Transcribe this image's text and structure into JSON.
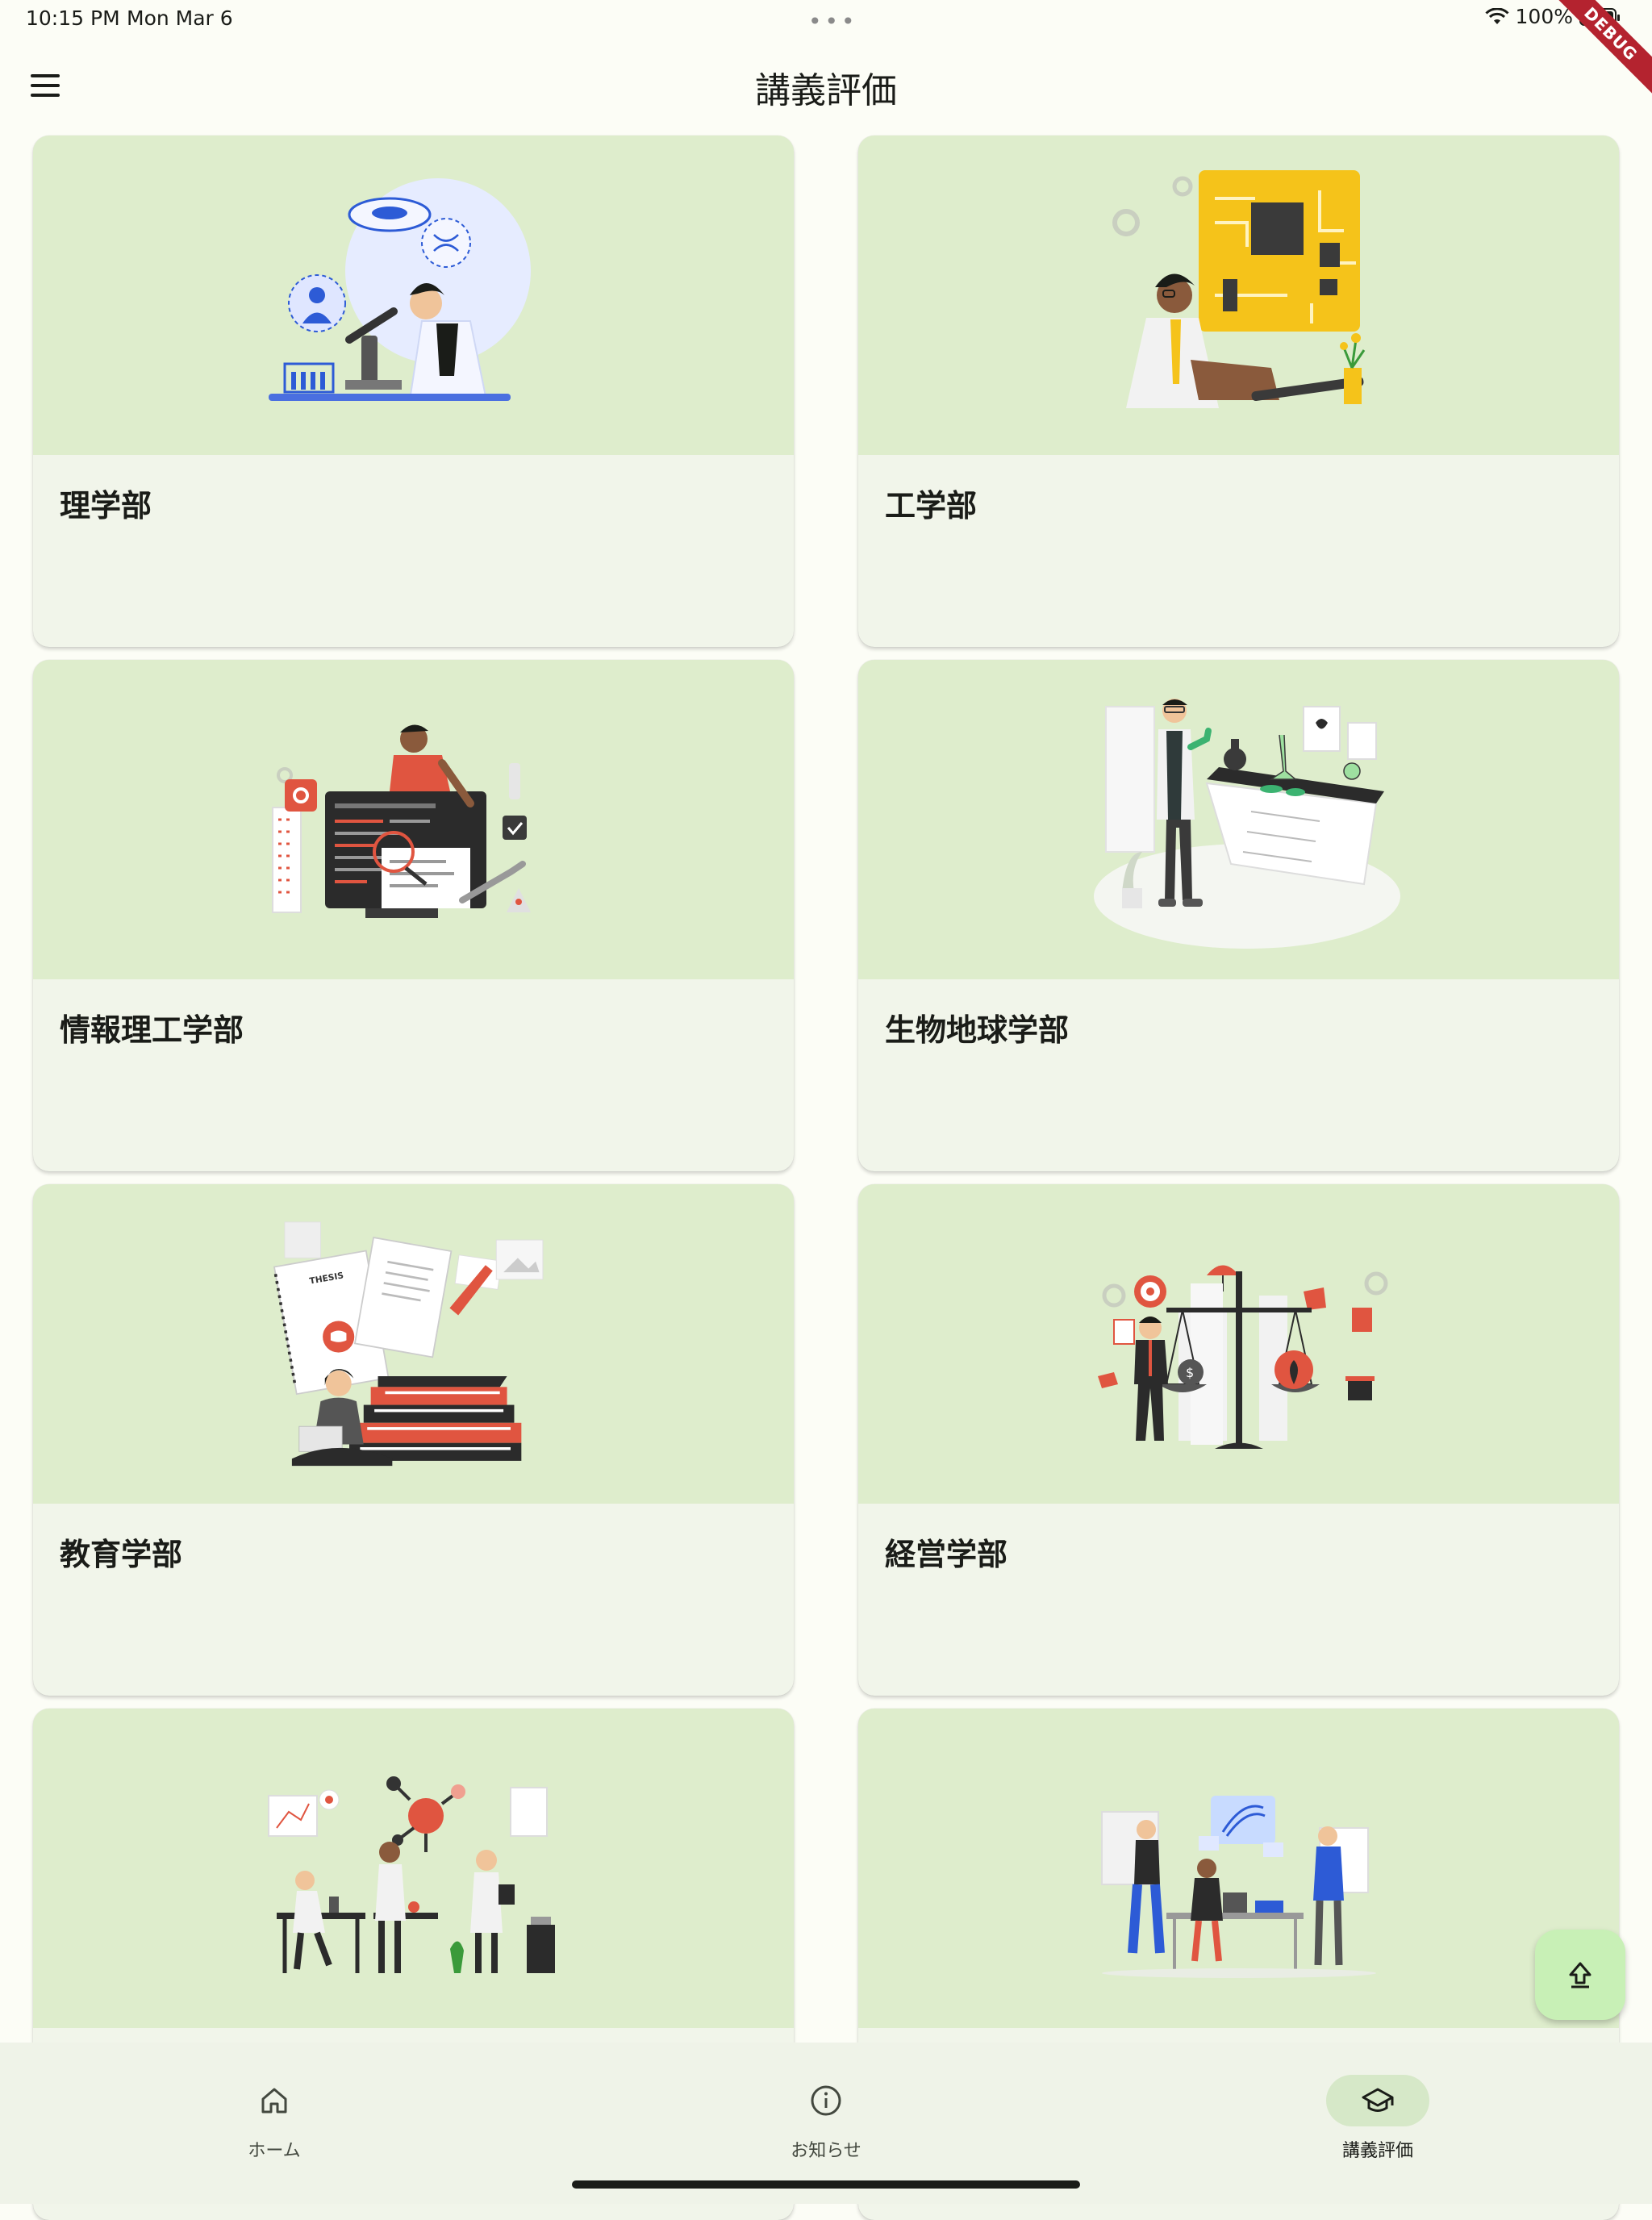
{
  "status_bar": {
    "time": "10:15 PM",
    "date": "Mon Mar 6",
    "battery": "100%"
  },
  "debug_banner": "DEBUG",
  "app_bar": {
    "title": "講義評価"
  },
  "faculties": [
    {
      "name": "理学部"
    },
    {
      "name": "工学部"
    },
    {
      "name": "情報理工学部"
    },
    {
      "name": "生物地球学部"
    },
    {
      "name": "教育学部"
    },
    {
      "name": "経営学部"
    },
    {
      "name": ""
    },
    {
      "name": ""
    }
  ],
  "bottom_nav": {
    "items": [
      {
        "label": "ホーム",
        "icon": "home-icon"
      },
      {
        "label": "お知らせ",
        "icon": "info-icon"
      },
      {
        "label": "講義評価",
        "icon": "school-icon",
        "active": true
      }
    ]
  },
  "fab": {
    "icon": "upload-icon"
  },
  "colors": {
    "card_top": "#deedcc",
    "card_body": "#f1f5ea",
    "nav_bg": "#eff3e8",
    "fab": "#c8f0b6"
  }
}
